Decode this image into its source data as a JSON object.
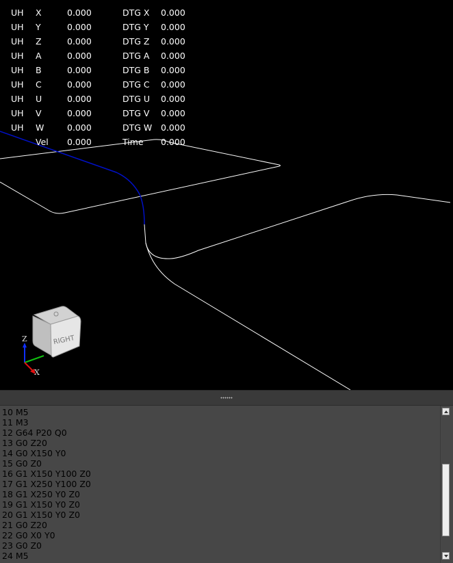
{
  "dro": {
    "rows": [
      {
        "prefix": "UH",
        "axis": "X",
        "value": "0.000",
        "dtg_label": "DTG X",
        "dtg_value": "0.000"
      },
      {
        "prefix": "UH",
        "axis": "Y",
        "value": "0.000",
        "dtg_label": "DTG Y",
        "dtg_value": "0.000"
      },
      {
        "prefix": "UH",
        "axis": "Z",
        "value": "0.000",
        "dtg_label": "DTG Z",
        "dtg_value": "0.000"
      },
      {
        "prefix": "UH",
        "axis": "A",
        "value": "0.000",
        "dtg_label": "DTG A",
        "dtg_value": "0.000"
      },
      {
        "prefix": "UH",
        "axis": "B",
        "value": "0.000",
        "dtg_label": "DTG B",
        "dtg_value": "0.000"
      },
      {
        "prefix": "UH",
        "axis": "C",
        "value": "0.000",
        "dtg_label": "DTG C",
        "dtg_value": "0.000"
      },
      {
        "prefix": "UH",
        "axis": "U",
        "value": "0.000",
        "dtg_label": "DTG U",
        "dtg_value": "0.000"
      },
      {
        "prefix": "UH",
        "axis": "V",
        "value": "0.000",
        "dtg_label": "DTG V",
        "dtg_value": "0.000"
      },
      {
        "prefix": "UH",
        "axis": "W",
        "value": "0.000",
        "dtg_label": "DTG W",
        "dtg_value": "0.000"
      }
    ],
    "vel_label": "Vel",
    "vel_value": "0.000",
    "time_label": "Time",
    "time_value": "0.000"
  },
  "view_cube": {
    "face_label": "RIGHT",
    "triad": {
      "z_label": "Z",
      "x_label": "X"
    }
  },
  "colors": {
    "background": "#000000",
    "feed_path": "#ffffff",
    "rapid_path": "#0010c8",
    "axis_x": "#e01010",
    "axis_y": "#10c010",
    "axis_z": "#1030ff",
    "gcode_bg": "#474747"
  },
  "gcode": {
    "lines": [
      "10 M5",
      "11 M3",
      "12 G64 P20 Q0",
      "13 G0 Z20",
      "14 G0 X150 Y0",
      "15 G0 Z0",
      "16 G1 X150 Y100 Z0",
      "17 G1 X250 Y100 Z0",
      "18 G1 X250 Y0 Z0",
      "19 G1 X150 Y0 Z0",
      "20 G1 X150 Y0 Z0",
      "21 G0 Z20",
      "22 G0 X0 Y0",
      "23 G0 Z0",
      "24 M5"
    ]
  }
}
